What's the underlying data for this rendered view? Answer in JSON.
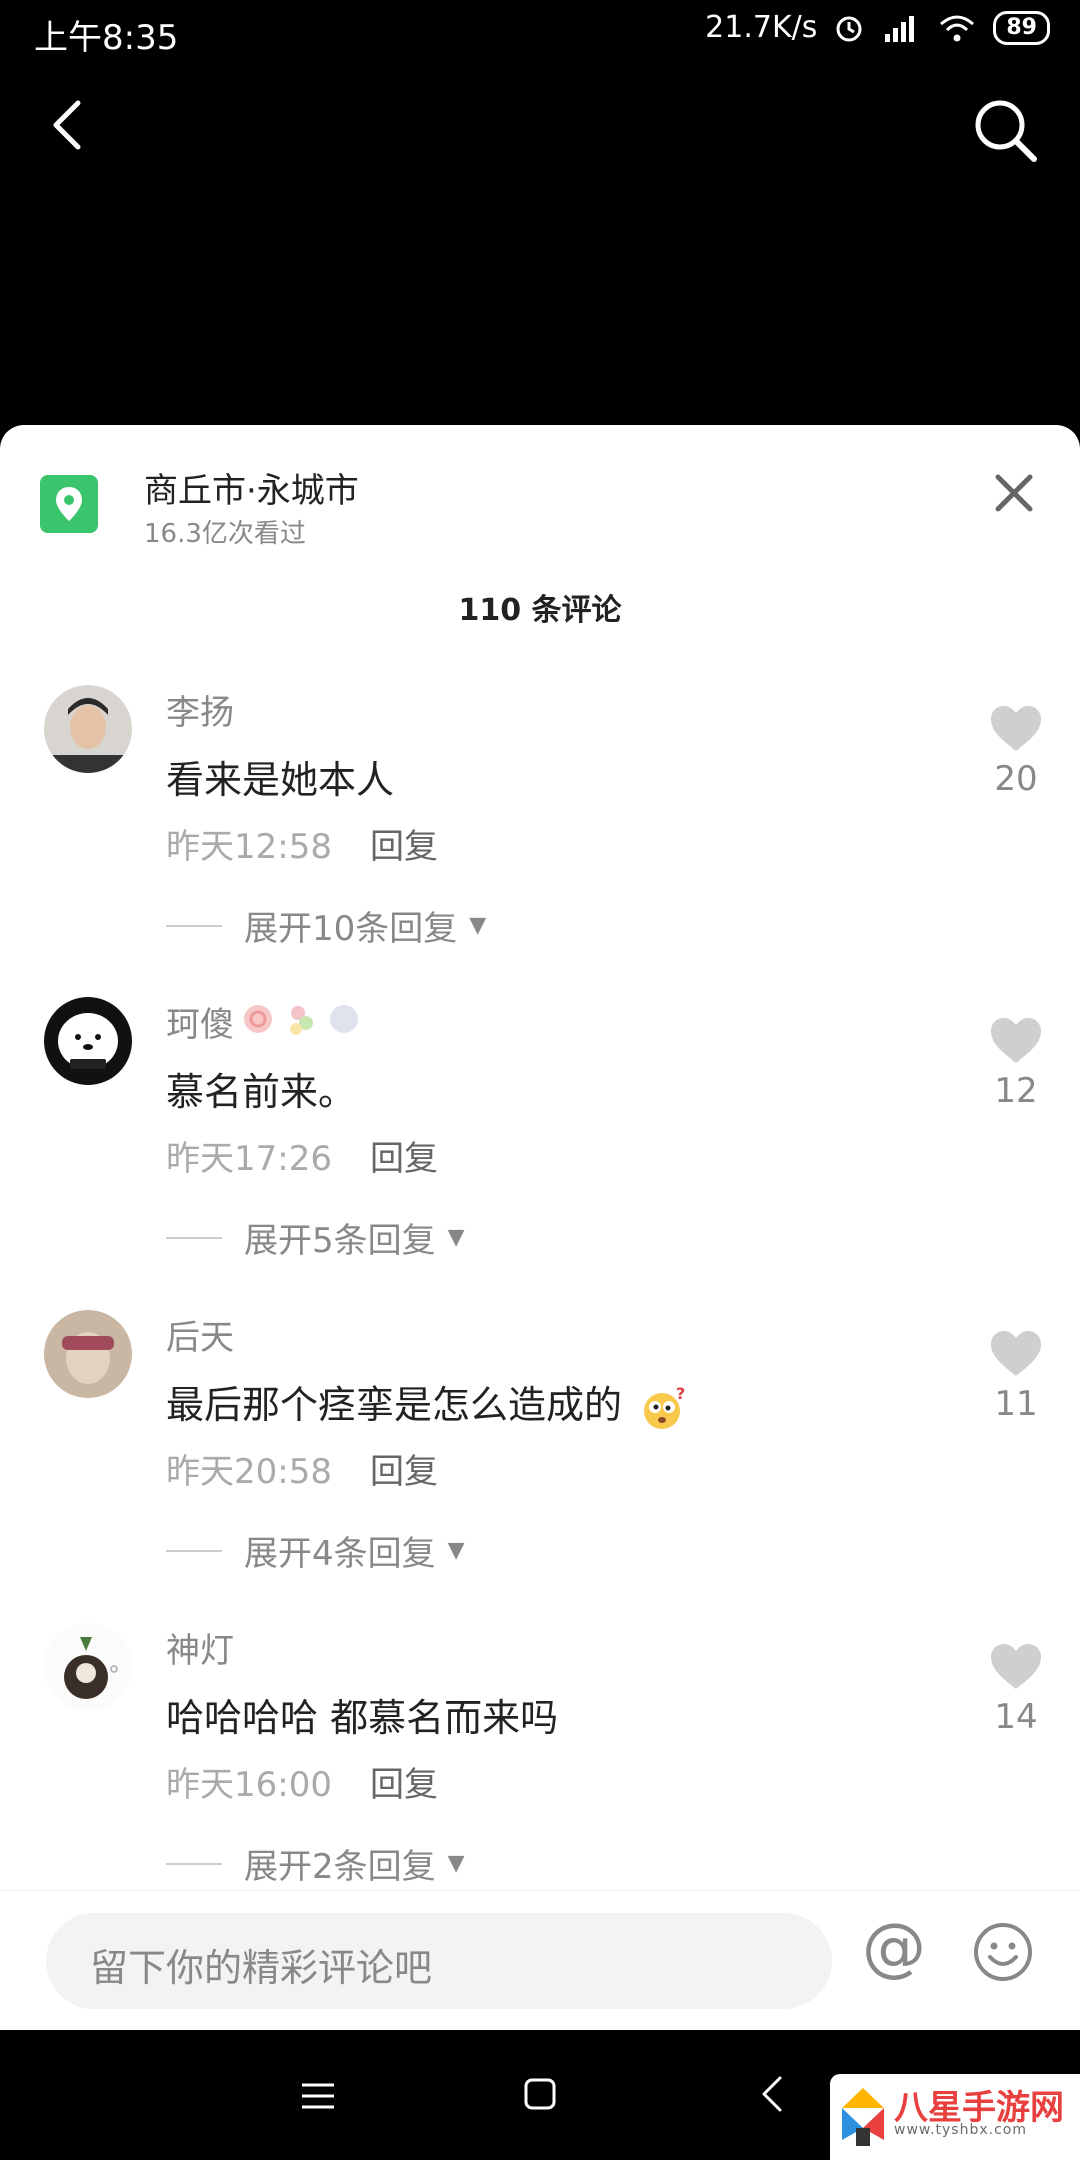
{
  "status_bar": {
    "time": "上午8:35",
    "speed": "21.7K/s",
    "battery": "89"
  },
  "location": {
    "title": "商丘市·永城市",
    "views": "16.3亿次看过"
  },
  "comments_header": "110 条评论",
  "comments": [
    {
      "name": "李扬",
      "text": "看来是她本人",
      "time": "昨天12:58",
      "reply": "回复",
      "expand": "展开10条回复",
      "likes": "20"
    },
    {
      "name": "珂傻",
      "text": "慕名前来。",
      "time": "昨天17:26",
      "reply": "回复",
      "expand": "展开5条回复",
      "likes": "12"
    },
    {
      "name": "后天",
      "text": "最后那个痉挛是怎么造成的",
      "time": "昨天20:58",
      "reply": "回复",
      "expand": "展开4条回复",
      "likes": "11"
    },
    {
      "name": "神灯",
      "text": "哈哈哈哈 都慕名而来吗",
      "time": "昨天16:00",
      "reply": "回复",
      "expand": "展开2条回复",
      "likes": "14"
    }
  ],
  "input": {
    "placeholder": "留下你的精彩评论吧",
    "at_symbol": "@"
  },
  "watermark": {
    "brand": "八星手游网",
    "url": "www.tyshbx.com"
  },
  "colors": {
    "location_icon": "#3ac46c",
    "watermark_red": "#e83f3f"
  }
}
